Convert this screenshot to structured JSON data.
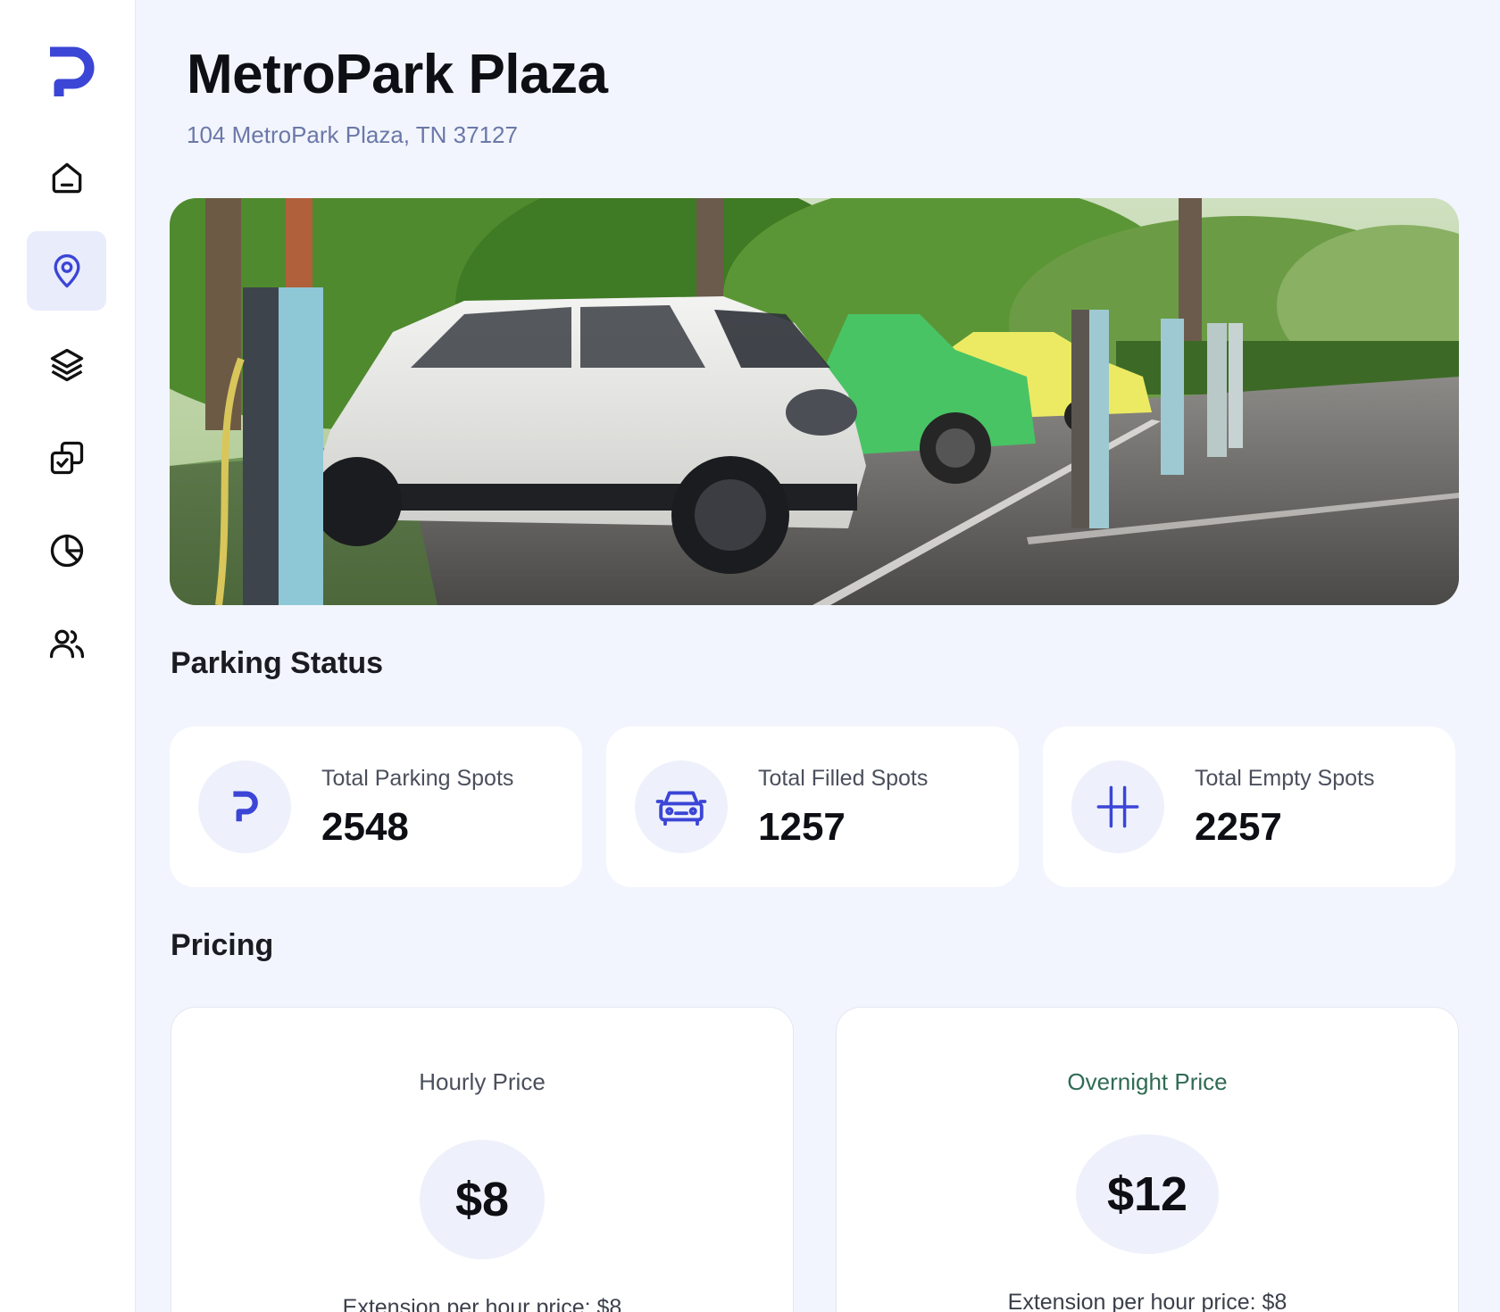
{
  "brand": {
    "logo_icon": "parking-p-logo",
    "accent": "#3b45d6"
  },
  "sidebar": {
    "items": [
      {
        "name": "home",
        "icon": "home-icon",
        "active": false
      },
      {
        "name": "locations",
        "icon": "map-pin-icon",
        "active": true
      },
      {
        "name": "layers",
        "icon": "layers-icon",
        "active": false
      },
      {
        "name": "tasks",
        "icon": "copy-check-icon",
        "active": false
      },
      {
        "name": "analytics",
        "icon": "pie-chart-icon",
        "active": false
      },
      {
        "name": "users",
        "icon": "users-icon",
        "active": false
      }
    ]
  },
  "header": {
    "title": "MetroPark Plaza",
    "address": "104 MetroPark Plaza, TN 37127"
  },
  "parking_status": {
    "heading": "Parking Status",
    "cards": [
      {
        "label": "Total Parking Spots",
        "value": "2548",
        "icon": "parking-p-icon"
      },
      {
        "label": "Total Filled Spots",
        "value": "1257",
        "icon": "car-icon"
      },
      {
        "label": "Total Empty Spots",
        "value": "2257",
        "icon": "parking-lines-icon"
      }
    ]
  },
  "pricing": {
    "heading": "Pricing",
    "cards": [
      {
        "label": "Hourly Price",
        "price": "$8",
        "extension": "Extension per hour price: $8"
      },
      {
        "label": "Overnight Price",
        "price": "$12",
        "extension": "Extension per hour price: $8"
      }
    ]
  }
}
